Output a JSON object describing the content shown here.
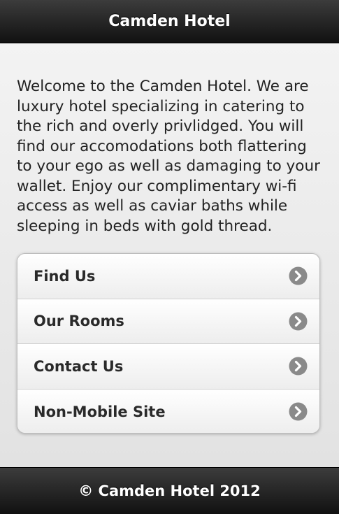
{
  "header": {
    "title": "Camden Hotel"
  },
  "intro": {
    "text": "Welcome to the Camden Hotel. We are luxury hotel specializing in catering to the rich and overly privlidged. You will find our accomodations both flattering to your ego as well as damaging to your wallet. Enjoy our complimentary wi-fi access as well as caviar baths while sleeping in beds with gold thread."
  },
  "menu": {
    "items": [
      {
        "label": "Find Us",
        "icon": "chevron-right-circle-icon"
      },
      {
        "label": "Our Rooms",
        "icon": "chevron-right-circle-icon"
      },
      {
        "label": "Contact Us",
        "icon": "chevron-right-circle-icon"
      },
      {
        "label": "Non-Mobile Site",
        "icon": "chevron-right-circle-icon"
      }
    ]
  },
  "footer": {
    "text": "© Camden Hotel 2012"
  },
  "colors": {
    "bar_dark": "#111111",
    "bar_light": "#3c3c3c",
    "page_background": "#e9e9e9",
    "arrow_icon": "#8a8a8a"
  }
}
